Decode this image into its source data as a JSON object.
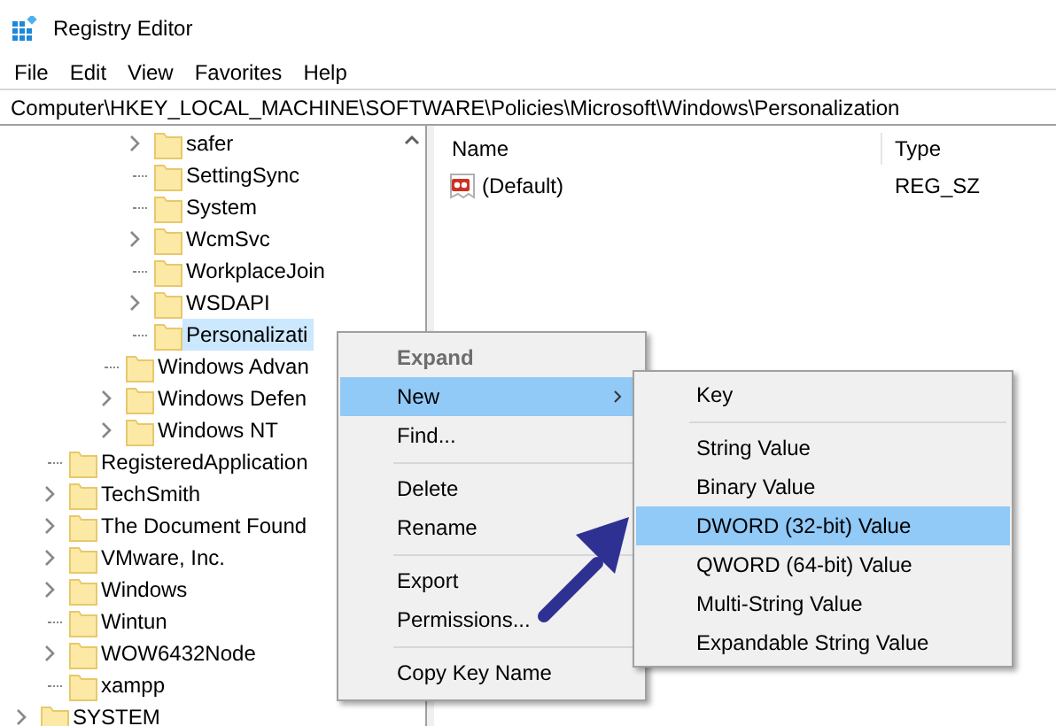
{
  "window": {
    "title": "Registry Editor"
  },
  "menu_bar": [
    "File",
    "Edit",
    "View",
    "Favorites",
    "Help"
  ],
  "address": "Computer\\HKEY_LOCAL_MACHINE\\SOFTWARE\\Policies\\Microsoft\\Windows\\Personalization",
  "tree": [
    {
      "children": [
        {
          "children": [
            {
              "children": [
                {
                  "children": [
                    {
                      "label": "safer",
                      "expandable": true,
                      "selected": false
                    },
                    {
                      "label": "SettingSync",
                      "expandable": false,
                      "selected": false
                    },
                    {
                      "label": "System",
                      "expandable": false,
                      "selected": false
                    },
                    {
                      "label": "WcmSvc",
                      "expandable": true,
                      "selected": false
                    },
                    {
                      "label": "WorkplaceJoin",
                      "expandable": false,
                      "selected": false
                    },
                    {
                      "label": "WSDAPI",
                      "expandable": true,
                      "selected": false
                    },
                    {
                      "label": "Personalizati",
                      "expandable": false,
                      "selected": true
                    }
                  ]
                },
                {
                  "label": "Windows Advan",
                  "expandable": false,
                  "selected": false
                },
                {
                  "label": "Windows Defen",
                  "expandable": true,
                  "selected": false
                },
                {
                  "label": "Windows NT",
                  "expandable": true,
                  "selected": false
                }
              ]
            }
          ]
        },
        {
          "label": "RegisteredApplication",
          "expandable": false,
          "selected": false
        },
        {
          "label": "TechSmith",
          "expandable": true,
          "selected": false
        },
        {
          "label": "The Document Found",
          "expandable": true,
          "selected": false
        },
        {
          "label": "VMware, Inc.",
          "expandable": true,
          "selected": false
        },
        {
          "label": "Windows",
          "expandable": true,
          "selected": false
        },
        {
          "label": "Wintun",
          "expandable": false,
          "selected": false
        },
        {
          "label": "WOW6432Node",
          "expandable": true,
          "selected": false
        },
        {
          "label": "xampp",
          "expandable": false,
          "selected": false
        }
      ]
    },
    {
      "label": "SYSTEM",
      "expandable": true,
      "selected": false
    }
  ],
  "values_list": {
    "columns": [
      "Name",
      "Type"
    ],
    "rows": [
      {
        "name": "(Default)",
        "type": "REG_SZ",
        "kind": "string"
      }
    ]
  },
  "context_menu": {
    "items": [
      {
        "kind": "item",
        "label": "Expand",
        "default": true,
        "disabled": true,
        "selected": false,
        "submenu": false
      },
      {
        "kind": "item",
        "label": "New",
        "default": false,
        "disabled": false,
        "selected": true,
        "submenu": true
      },
      {
        "kind": "item",
        "label": "Find...",
        "default": false,
        "disabled": false,
        "selected": false,
        "submenu": false
      },
      {
        "kind": "separator"
      },
      {
        "kind": "item",
        "label": "Delete",
        "default": false,
        "disabled": false,
        "selected": false,
        "submenu": false
      },
      {
        "kind": "item",
        "label": "Rename",
        "default": false,
        "disabled": false,
        "selected": false,
        "submenu": false
      },
      {
        "kind": "separator"
      },
      {
        "kind": "item",
        "label": "Export",
        "default": false,
        "disabled": false,
        "selected": false,
        "submenu": false
      },
      {
        "kind": "item",
        "label": "Permissions...",
        "default": false,
        "disabled": false,
        "selected": false,
        "submenu": false
      },
      {
        "kind": "separator"
      },
      {
        "kind": "item",
        "label": "Copy Key Name",
        "default": false,
        "disabled": false,
        "selected": false,
        "submenu": false
      }
    ]
  },
  "submenu": {
    "items": [
      {
        "kind": "item",
        "label": "Key",
        "default": false,
        "disabled": false,
        "selected": false,
        "submenu": false
      },
      {
        "kind": "separator"
      },
      {
        "kind": "item",
        "label": "String Value",
        "default": false,
        "disabled": false,
        "selected": false,
        "submenu": false
      },
      {
        "kind": "item",
        "label": "Binary Value",
        "default": false,
        "disabled": false,
        "selected": false,
        "submenu": false
      },
      {
        "kind": "item",
        "label": "DWORD (32-bit) Value",
        "default": false,
        "disabled": false,
        "selected": true,
        "submenu": false
      },
      {
        "kind": "item",
        "label": "QWORD (64-bit) Value",
        "default": false,
        "disabled": false,
        "selected": false,
        "submenu": false
      },
      {
        "kind": "item",
        "label": "Multi-String Value",
        "default": false,
        "disabled": false,
        "selected": false,
        "submenu": false
      },
      {
        "kind": "item",
        "label": "Expandable String Value",
        "default": false,
        "disabled": false,
        "selected": false,
        "submenu": false
      }
    ]
  }
}
